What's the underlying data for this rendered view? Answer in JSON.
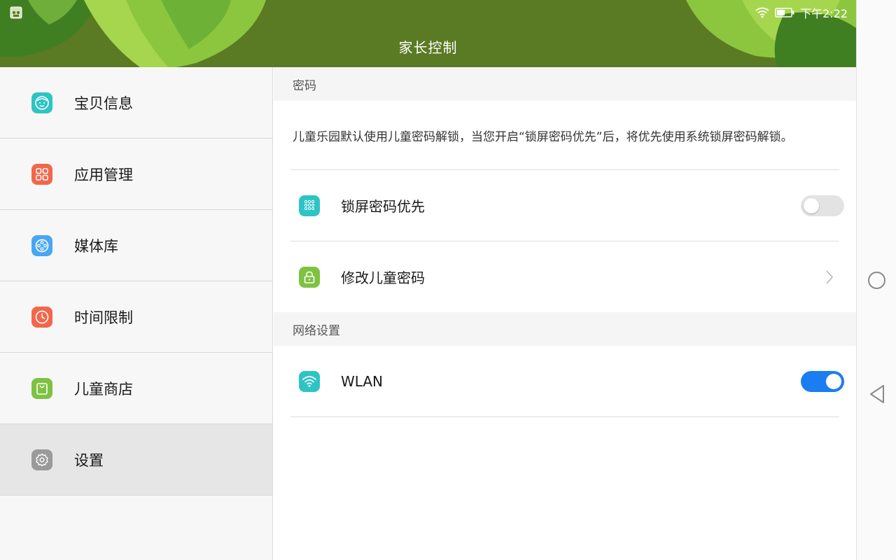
{
  "status_bar": {
    "time": "下午2:22",
    "app_icon": "kids-app-icon",
    "wifi_icon": "wifi-icon",
    "battery_icon": "battery-icon"
  },
  "header": {
    "title": "家长控制"
  },
  "sidebar": {
    "items": [
      {
        "label": "宝贝信息",
        "icon": "baby-face-icon",
        "color": "#2ec4c4"
      },
      {
        "label": "应用管理",
        "icon": "app-grid-icon",
        "color": "#f2674a"
      },
      {
        "label": "媒体库",
        "icon": "film-reel-icon",
        "color": "#4aa6f0"
      },
      {
        "label": "时间限制",
        "icon": "clock-icon",
        "color": "#f2674a"
      },
      {
        "label": "儿童商店",
        "icon": "shopping-bag-icon",
        "color": "#7ec242"
      },
      {
        "label": "设置",
        "icon": "gear-icon",
        "color": "#9a9a9a"
      }
    ],
    "active_index": 5
  },
  "content": {
    "password_section": {
      "title": "密码",
      "description": "儿童乐园默认使用儿童密码解锁，当您开启“锁屏密码优先”后，将优先使用系统锁屏密码解锁。",
      "lock_screen_priority": {
        "label": "锁屏密码优先",
        "icon": "keypad-icon",
        "color": "#2ec4c4",
        "enabled": false
      },
      "change_password": {
        "label": "修改儿童密码",
        "icon": "lock-icon",
        "color": "#7ec242"
      }
    },
    "network_section": {
      "title": "网络设置",
      "wlan": {
        "label": "WLAN",
        "icon": "wifi-icon",
        "color": "#2ec4c4",
        "enabled": true
      }
    }
  },
  "colors": {
    "toggle_on": "#1a7df2",
    "toggle_off": "#e3e3e3",
    "header_green": "#5a7a24"
  }
}
